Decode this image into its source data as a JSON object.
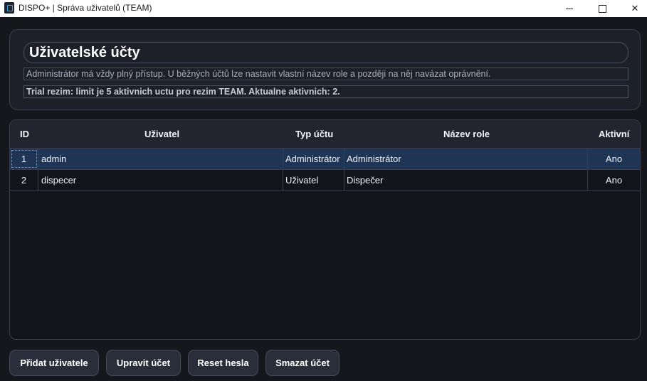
{
  "window": {
    "title": "DISPO+ | Správa uživatelů (TEAM)",
    "icon": "app-icon"
  },
  "header": {
    "title": "Uživatelské účty",
    "info": "Administrátor má vždy plný přístup. U běžných účtů lze nastavit vlastní název role a později na něj navázat oprávnění.",
    "trial": "Trial rezim: limit je 5 aktivnich uctu pro rezim TEAM. Aktualne aktivnich: 2."
  },
  "table": {
    "columns": [
      "ID",
      "Uživatel",
      "Typ účtu",
      "Název role",
      "Aktivní"
    ],
    "rows": [
      {
        "id": "1",
        "user": "admin",
        "type": "Administrátor",
        "role": "Administrátor",
        "active": "Ano",
        "selected": true
      },
      {
        "id": "2",
        "user": "dispecer",
        "type": "Uživatel",
        "role": "Dispečer",
        "active": "Ano",
        "selected": false
      }
    ]
  },
  "actions": {
    "add": "Přidat uživatele",
    "edit": "Upravit účet",
    "reset": "Reset hesla",
    "delete": "Smazat účet"
  },
  "colors": {
    "background": "#16171c",
    "panel": "#1e2029",
    "selected_row": "#1f3555",
    "button": "#2a2e3b"
  }
}
